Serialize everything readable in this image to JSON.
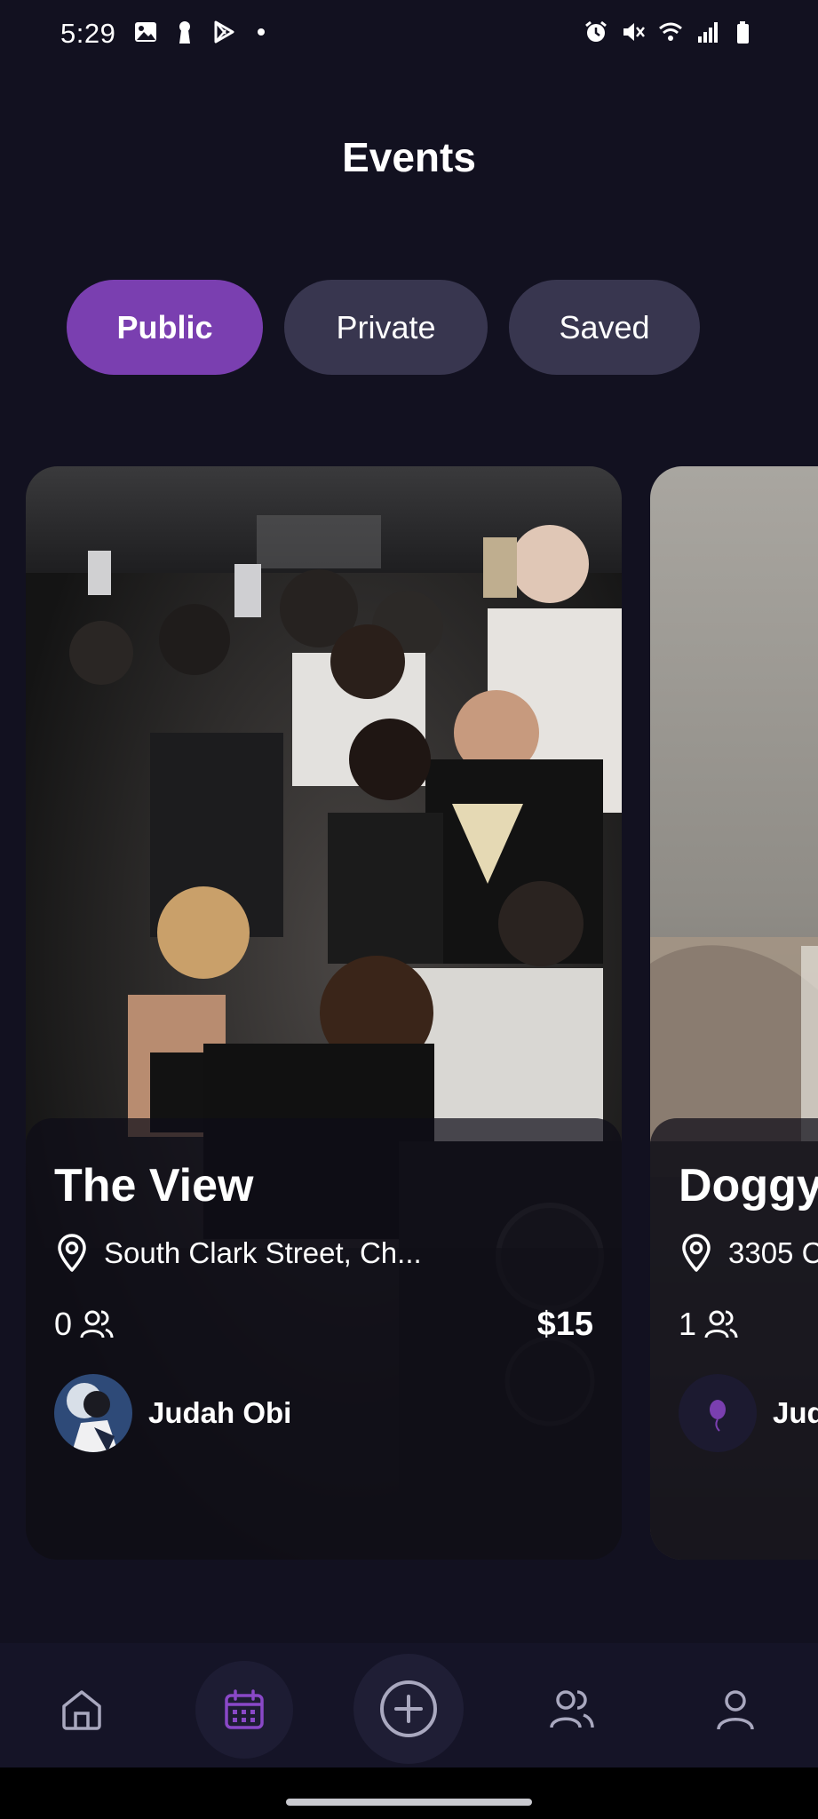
{
  "status_bar": {
    "time": "5:29"
  },
  "header": {
    "title": "Events"
  },
  "tabs": [
    {
      "label": "Public",
      "active": true
    },
    {
      "label": "Private",
      "active": false
    },
    {
      "label": "Saved",
      "active": false
    }
  ],
  "events": [
    {
      "title": "The View",
      "location": "South Clark Street, Ch...",
      "attendees": "0",
      "price": "$15",
      "host": "Judah Obi"
    },
    {
      "title": "Doggy",
      "location": "3305 C",
      "attendees": "1",
      "price": "",
      "host": "Jud"
    }
  ],
  "nav": {
    "items": [
      "home-icon",
      "calendar-icon",
      "add-circle-icon",
      "friends-icon",
      "profile-icon"
    ],
    "active": "calendar-icon"
  },
  "colors": {
    "background": "#121120",
    "accent": "#7a3fb0",
    "tab_inactive": "#38364f"
  }
}
